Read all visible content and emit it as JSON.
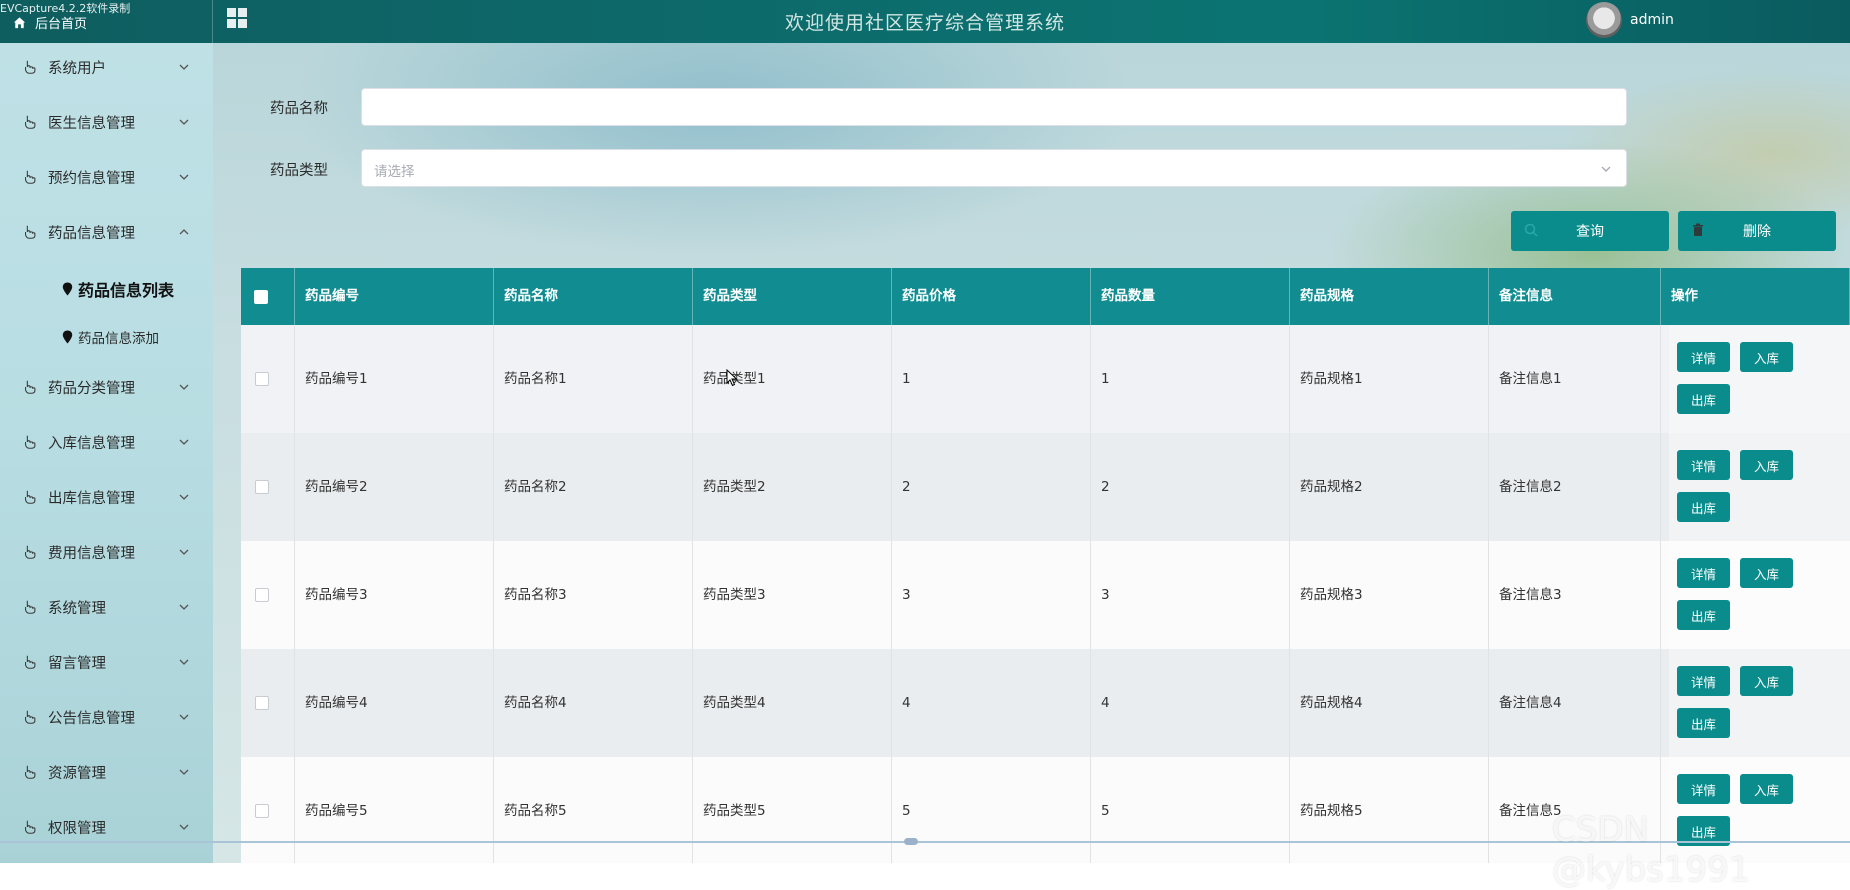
{
  "recorder_caption": "EVCapture4.2.2软件录制",
  "header": {
    "home_label": "后台首页",
    "title": "欢迎使用社区医疗综合管理系统",
    "username": "admin"
  },
  "sidebar": {
    "items": [
      {
        "label": "系统用户"
      },
      {
        "label": "医生信息管理"
      },
      {
        "label": "预约信息管理"
      },
      {
        "label": "药品信息管理"
      },
      {
        "label": "药品分类管理"
      },
      {
        "label": "入库信息管理"
      },
      {
        "label": "出库信息管理"
      },
      {
        "label": "费用信息管理"
      },
      {
        "label": "系统管理"
      },
      {
        "label": "留言管理"
      },
      {
        "label": "公告信息管理"
      },
      {
        "label": "资源管理"
      },
      {
        "label": "权限管理"
      }
    ],
    "subitems": [
      {
        "label": "药品信息列表",
        "active": true
      },
      {
        "label": "药品信息添加",
        "active": false
      }
    ]
  },
  "search": {
    "name_label": "药品名称",
    "name_value": "",
    "type_label": "药品类型",
    "type_placeholder": "请选择",
    "query_button": "查询",
    "delete_button": "删除"
  },
  "table": {
    "columns": [
      "药品编号",
      "药品名称",
      "药品类型",
      "药品价格",
      "药品数量",
      "药品规格",
      "备注信息",
      "操作"
    ],
    "rows": [
      {
        "code": "药品编号1",
        "name": "药品名称1",
        "type": "药品类型1",
        "price": "1",
        "qty": "1",
        "spec": "药品规格1",
        "note": "备注信息1"
      },
      {
        "code": "药品编号2",
        "name": "药品名称2",
        "type": "药品类型2",
        "price": "2",
        "qty": "2",
        "spec": "药品规格2",
        "note": "备注信息2"
      },
      {
        "code": "药品编号3",
        "name": "药品名称3",
        "type": "药品类型3",
        "price": "3",
        "qty": "3",
        "spec": "药品规格3",
        "note": "备注信息3"
      },
      {
        "code": "药品编号4",
        "name": "药品名称4",
        "type": "药品类型4",
        "price": "4",
        "qty": "4",
        "spec": "药品规格4",
        "note": "备注信息4"
      },
      {
        "code": "药品编号5",
        "name": "药品名称5",
        "type": "药品类型5",
        "price": "5",
        "qty": "5",
        "spec": "药品规格5",
        "note": "备注信息5"
      }
    ],
    "row_actions": {
      "detail": "详情",
      "stock_in": "入库",
      "stock_out": "出库"
    }
  },
  "watermark": "CSDN @kybs1991",
  "colors": {
    "accent": "#0b8c8c",
    "header_bg": "#118d92",
    "topbar": "#0d6a6b"
  }
}
